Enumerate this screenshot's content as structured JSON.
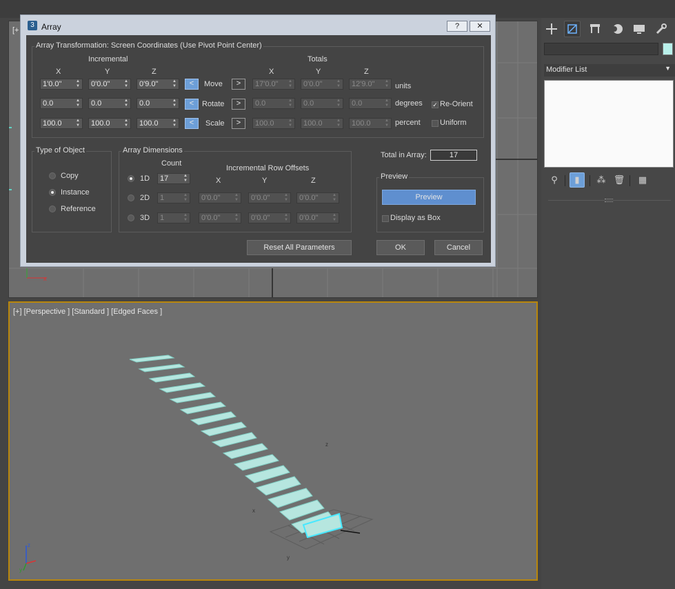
{
  "dialog": {
    "title": "Array",
    "help_label": "?",
    "close_label": "✕",
    "transform_group_title": "Array Transformation: Screen Coordinates (Use Pivot Point Center)",
    "incremental_label": "Incremental",
    "totals_label": "Totals",
    "axis_x": "X",
    "axis_y": "Y",
    "axis_z": "Z",
    "move": {
      "label": "Move",
      "inc": [
        "1'0.0\"",
        "0'0.0\"",
        "0'9.0\""
      ],
      "tot": [
        "17'0.0\"",
        "0'0.0\"",
        "12'9.0\""
      ],
      "unit": "units"
    },
    "rotate": {
      "label": "Rotate",
      "inc": [
        "0.0",
        "0.0",
        "0.0"
      ],
      "tot": [
        "0.0",
        "0.0",
        "0.0"
      ],
      "unit": "degrees",
      "option": "Re-Orient"
    },
    "scale": {
      "label": "Scale",
      "inc": [
        "100.0",
        "100.0",
        "100.0"
      ],
      "tot": [
        "100.0",
        "100.0",
        "100.0"
      ],
      "unit": "percent",
      "option": "Uniform"
    },
    "left_arrow": "<",
    "right_arrow": ">",
    "type_group_title": "Type of Object",
    "types": [
      "Copy",
      "Instance",
      "Reference"
    ],
    "dims_group_title": "Array Dimensions",
    "count_label": "Count",
    "row_offsets_label": "Incremental Row Offsets",
    "dims": [
      {
        "label": "1D",
        "count": "17"
      },
      {
        "label": "2D",
        "count": "1",
        "x": "0'0.0\"",
        "y": "0'0.0\"",
        "z": "0'0.0\""
      },
      {
        "label": "3D",
        "count": "1",
        "x": "0'0.0\"",
        "y": "0'0.0\"",
        "z": "0'0.0\""
      }
    ],
    "total_label": "Total in Array:",
    "total_value": "17",
    "preview_group_title": "Preview",
    "preview_button": "Preview",
    "display_as_box": "Display as Box",
    "reset_button": "Reset All Parameters",
    "ok_button": "OK",
    "cancel_button": "Cancel"
  },
  "viewport_top": {
    "label": "[+"
  },
  "viewport_persp": {
    "label": "[+] [Perspective ] [Standard ] [Edged Faces ]",
    "axis_z": "z",
    "axis_x": "x",
    "axis_y": "y"
  },
  "command_panel": {
    "tabs": [
      "create-icon",
      "modify-icon",
      "hierarchy-icon",
      "motion-icon",
      "display-icon",
      "utilities-icon"
    ],
    "modifier_list": "Modifier List",
    "object_color": "#b9f0ea"
  },
  "colors": {
    "accent": "#6d9fd8",
    "object": "#b6e6df",
    "active_viewport_border": "#b8860b"
  }
}
